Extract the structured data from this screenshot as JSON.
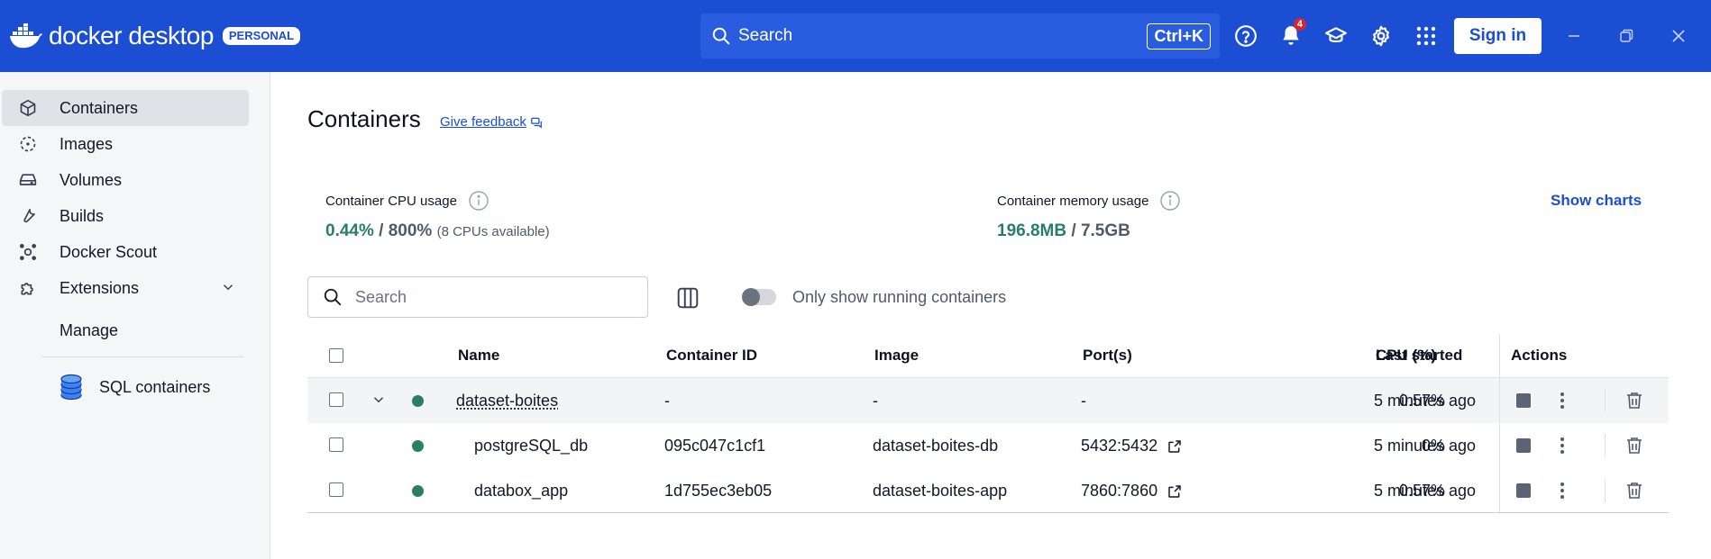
{
  "header": {
    "app_name": "docker desktop",
    "plan_badge": "PERSONAL",
    "search_label": "Search",
    "search_shortcut": "Ctrl+K",
    "notification_count": "4",
    "sign_in_label": "Sign in",
    "accent_color": "#1c4ed3"
  },
  "sidebar": {
    "items": [
      {
        "label": "Containers",
        "icon": "box-icon",
        "active": true
      },
      {
        "label": "Images",
        "icon": "image-layers-icon"
      },
      {
        "label": "Volumes",
        "icon": "drive-icon"
      },
      {
        "label": "Builds",
        "icon": "wrench-icon"
      },
      {
        "label": "Docker Scout",
        "icon": "scout-icon"
      },
      {
        "label": "Extensions",
        "icon": "puzzle-icon"
      }
    ],
    "manage_label": "Manage",
    "extensions": [
      {
        "label": "SQL containers",
        "icon": "database-icon"
      }
    ]
  },
  "main": {
    "title": "Containers",
    "feedback_label": "Give feedback",
    "cpu": {
      "label": "Container CPU usage",
      "value": "0.44%",
      "total": " / 800%",
      "note": "(8 CPUs available)"
    },
    "memory": {
      "label": "Container memory usage",
      "value": "196.8MB",
      "total": " / 7.5GB"
    },
    "show_charts_label": "Show charts",
    "search_placeholder": "Search",
    "toggle_label": "Only show running containers",
    "status_color": "#2a7d6b"
  },
  "table": {
    "columns": {
      "name": "Name",
      "container_id": "Container ID",
      "image": "Image",
      "ports": "Port(s)",
      "cpu": "CPU (%)",
      "last_started": "Last started",
      "actions": "Actions"
    },
    "rows": [
      {
        "name": "dataset-boites",
        "container_id": "-",
        "image": "-",
        "ports": "-",
        "cpu": "0.57%",
        "last_started": "5 minutes ago",
        "group": true
      },
      {
        "name": "postgreSQL_db",
        "container_id": "095c047c1cf1",
        "image": "dataset-boites-db",
        "ports": "5432:5432",
        "cpu": "0%",
        "last_started": "5 minutes ago"
      },
      {
        "name": "databox_app",
        "container_id": "1d755ec3eb05",
        "image": "dataset-boites-app",
        "ports": "7860:7860",
        "cpu": "0.57%",
        "last_started": "5 minutes ago"
      }
    ]
  }
}
